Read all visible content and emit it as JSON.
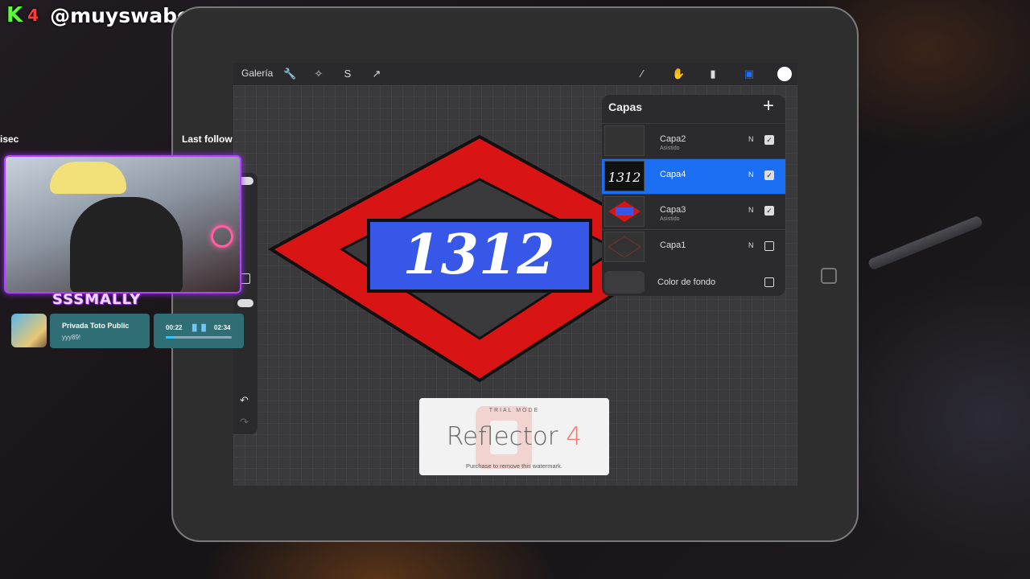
{
  "overlay": {
    "k_letter": "K",
    "k_number": "4",
    "handle": "@muyswabe_store",
    "sec_label": "isec",
    "last_follow_label": "Last follow",
    "streamer_name": "SSSMALLY",
    "music": {
      "title": "Privada Toto Public",
      "artist": "yyy89!",
      "elapsed": "00:22",
      "duration": "02:34",
      "progress_fraction": 0.14
    }
  },
  "app": {
    "gallery_label": "Galería",
    "toolbar_icons": [
      "wrench-icon",
      "magic-wand-icon",
      "selection-icon",
      "transform-arrow-icon"
    ],
    "right_tools": [
      "brush-icon",
      "smudge-icon",
      "eraser-icon",
      "layers-icon",
      "color-swatch-icon"
    ],
    "accent": "#1c6ef2",
    "canvas_text": "1312",
    "canvas_colors": {
      "diamond": "#d91414",
      "banner": "#3657e8",
      "outline": "#111111"
    }
  },
  "layers_panel": {
    "title": "Capas",
    "add_label": "+",
    "layers": [
      {
        "name": "Capa2",
        "sub": "Asistido",
        "mode": "N",
        "visible": true,
        "selected": false
      },
      {
        "name": "Capa4",
        "sub": "",
        "mode": "N",
        "visible": true,
        "selected": true
      },
      {
        "name": "Capa3",
        "sub": "Asistido",
        "mode": "N",
        "visible": true,
        "selected": false
      },
      {
        "name": "Capa1",
        "sub": "",
        "mode": "N",
        "visible": false,
        "selected": false
      }
    ],
    "background": {
      "name": "Color de fondo",
      "visible": false
    }
  },
  "watermark": {
    "trial": "TRIAL MODE",
    "name": "Reflector",
    "version": "4",
    "sub": "Purchase to remove this watermark."
  }
}
